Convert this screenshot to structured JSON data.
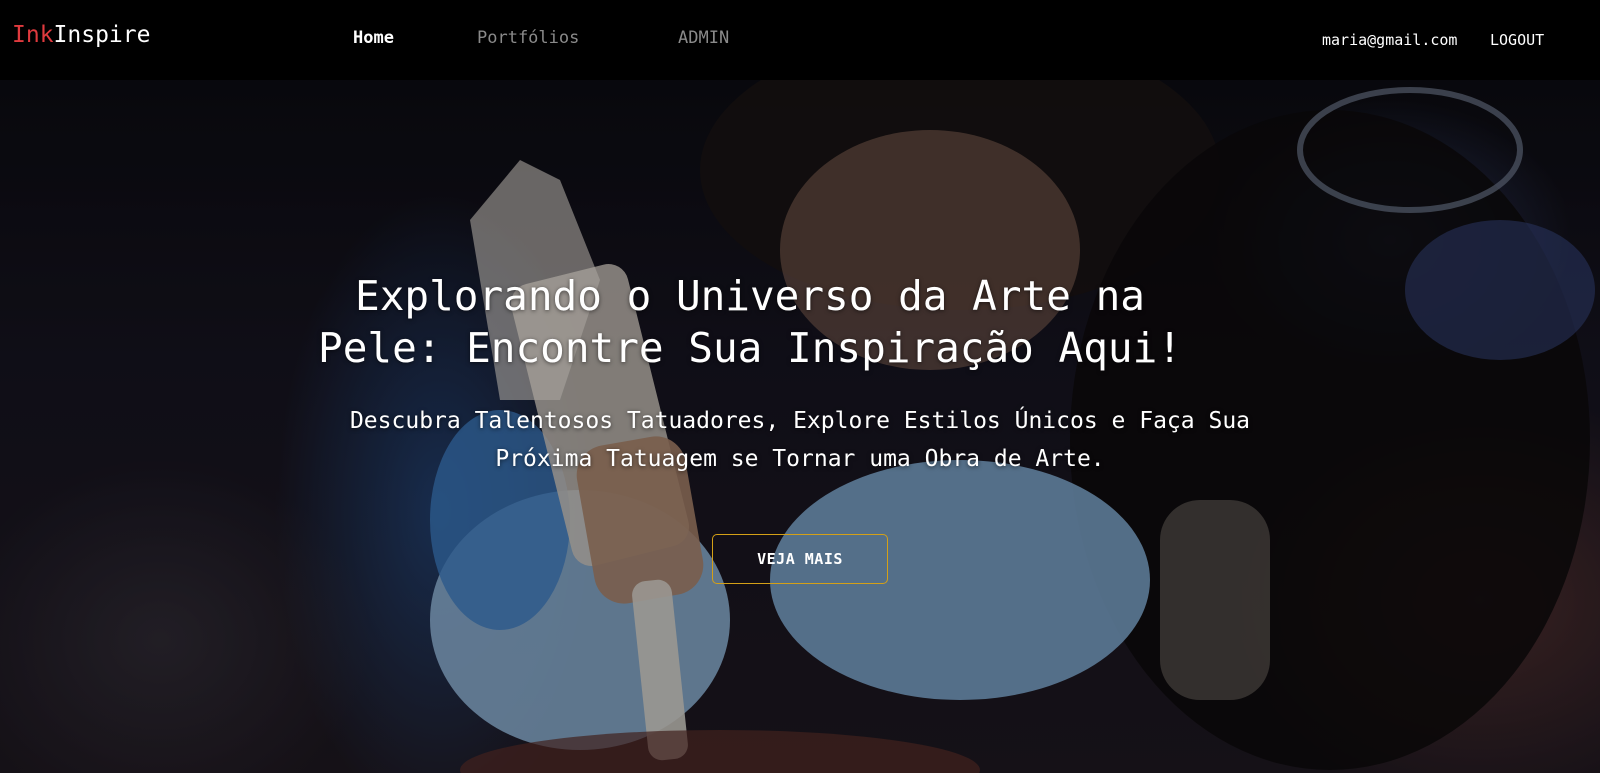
{
  "navbar": {
    "logo": {
      "part1": "Ink",
      "part2": "Inspire"
    },
    "links": [
      {
        "label": "Home",
        "active": true
      },
      {
        "label": "Portfólios",
        "active": false
      },
      {
        "label": "ADMIN",
        "active": false
      }
    ],
    "user_email": "maria@gmail.com",
    "logout_label": "LOGOUT"
  },
  "hero": {
    "title_line1": "Explorando o Universo da Arte na",
    "title_line2": "Pele: Encontre Sua Inspiração Aqui!",
    "subtitle_line1": "Descubra Talentosos Tatuadores, Explore Estilos Únicos e Faça Sua",
    "subtitle_line2": "Próxima Tatuagem se Tornar uma Obra de Arte.",
    "cta_label": "VEJA MAIS",
    "image_icon": "tattoo-artist-photo"
  },
  "colors": {
    "logo_accent": "#e03a3e",
    "nav_active": "#ffffff",
    "nav_inactive": "#8a8a8a",
    "cta_border": "#d4a017",
    "navbar_bg": "#000000"
  }
}
